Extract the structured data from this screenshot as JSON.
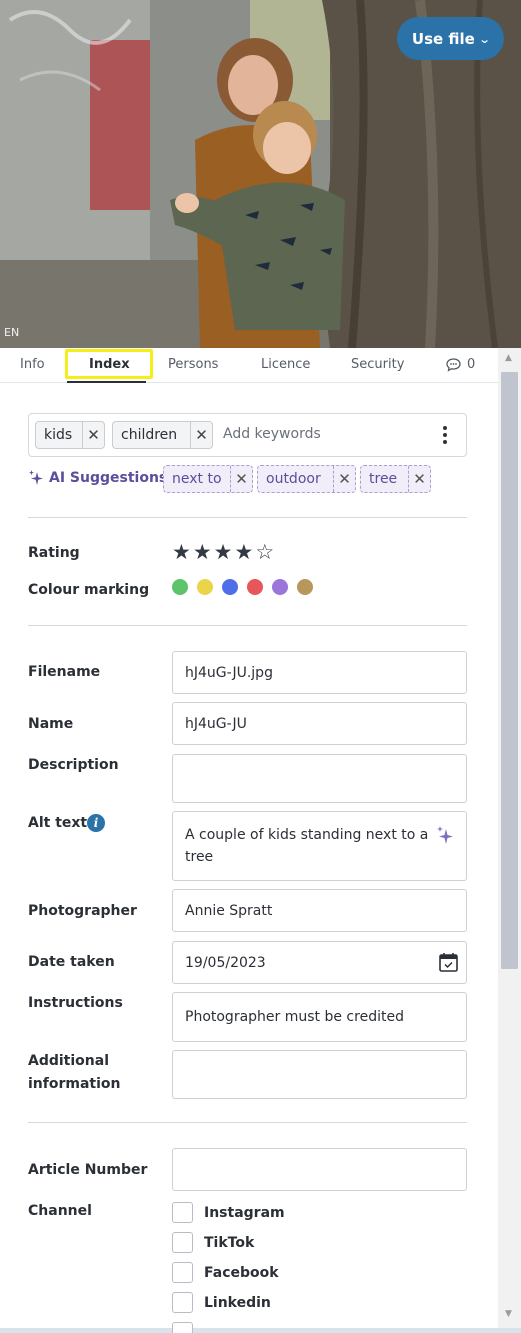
{
  "header": {
    "use_file_label": "Use file",
    "lang_badge": "EN"
  },
  "tabs": [
    {
      "label": "Info"
    },
    {
      "label": "Index",
      "active": true
    },
    {
      "label": "Persons"
    },
    {
      "label": "Licence"
    },
    {
      "label": "Security"
    },
    {
      "label": "0",
      "icon": "comment-icon"
    }
  ],
  "keywords": {
    "chips": [
      "kids",
      "children"
    ],
    "placeholder": "Add keywords"
  },
  "ai_suggestions": {
    "label": "AI Suggestions",
    "chips": [
      "next to",
      "outdoor",
      "tree"
    ]
  },
  "rating": {
    "label": "Rating",
    "value": 4,
    "max": 5
  },
  "colour_marking": {
    "label": "Colour marking",
    "colors": [
      "#5cc46a",
      "#ecd44a",
      "#4f6fe8",
      "#e5575a",
      "#9b75d9",
      "#b8975a"
    ]
  },
  "fields": {
    "filename": {
      "label": "Filename",
      "value": "hJ4uG-JU.jpg"
    },
    "name": {
      "label": "Name",
      "value": "hJ4uG-JU"
    },
    "description": {
      "label": "Description",
      "value": ""
    },
    "alt_text": {
      "label": "Alt text",
      "value": "A couple of kids standing next to a tree"
    },
    "photographer": {
      "label": "Photographer",
      "value": "Annie Spratt"
    },
    "date_taken": {
      "label": "Date taken",
      "value": "19/05/2023"
    },
    "instructions": {
      "label": "Instructions",
      "value": "Photographer must be credited"
    },
    "additional_information": {
      "label_line1": "Additional",
      "label_line2": "information",
      "value": ""
    },
    "article_number": {
      "label": "Article Number",
      "value": ""
    }
  },
  "channel": {
    "label": "Channel",
    "options": [
      "Instagram",
      "TikTok",
      "Facebook",
      "Linkedin"
    ]
  },
  "colors": {
    "accent": "#2a72a8",
    "ai_purple": "#5b4e9b",
    "highlight": "#f5ee19"
  }
}
